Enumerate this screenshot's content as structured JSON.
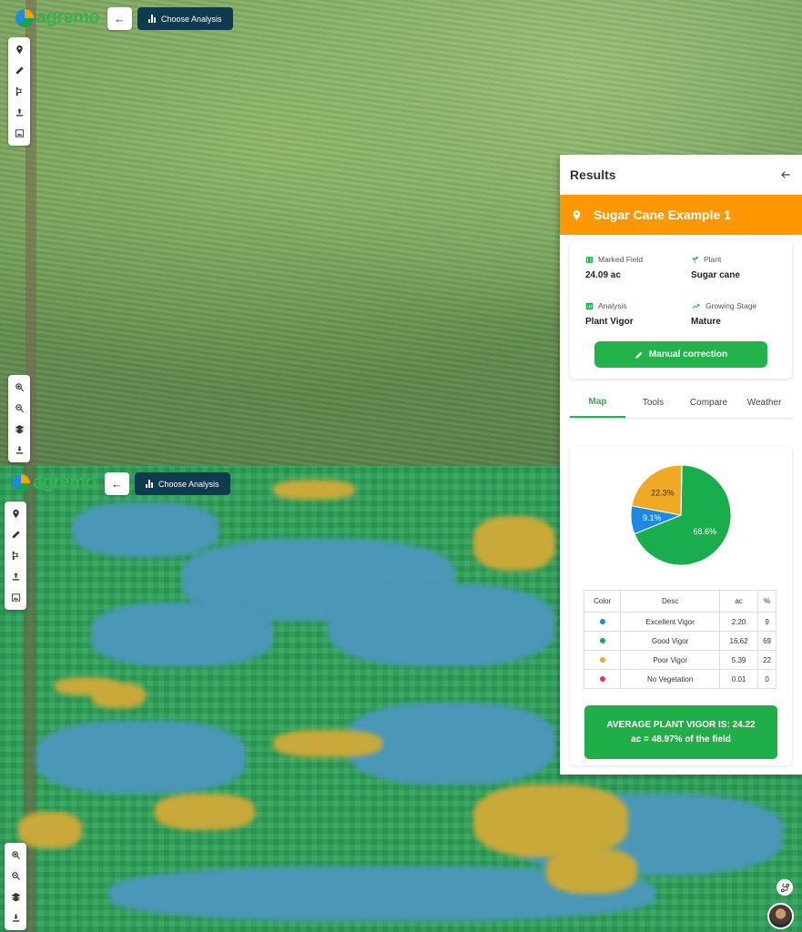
{
  "app": {
    "logo_text": "agremo"
  },
  "toolbar": {
    "back_icon": "←",
    "choose_analysis_label": "Choose Analysis"
  },
  "tools": [
    "pin-icon",
    "ruler-icon",
    "flag-icon",
    "upload-icon",
    "image-icon"
  ],
  "zoom_tools": [
    "zoom-in-icon",
    "zoom-out-icon",
    "layers-icon",
    "download-icon"
  ],
  "results": {
    "title": "Results",
    "field_name": "Sugar Cane Example 1",
    "info": {
      "marked_field_label": "Marked Field",
      "marked_field_value": "24.09 ac",
      "plant_label": "Plant",
      "plant_value": "Sugar cane",
      "analysis_label": "Analysis",
      "analysis_value": "Plant Vigor",
      "growing_stage_label": "Growing Stage",
      "growing_stage_value": "Mature"
    },
    "manual_correction_label": "Manual correction",
    "tabs": [
      {
        "label": "Map",
        "active": true
      },
      {
        "label": "Tools",
        "active": false
      },
      {
        "label": "Compare",
        "active": false
      },
      {
        "label": "Weather",
        "active": false
      }
    ],
    "table": {
      "headers": [
        "Color",
        "Desc",
        "ac",
        "%"
      ],
      "rows": [
        {
          "desc": "Excellent Vigor",
          "ac": "2.20",
          "pct": "9",
          "color": "#1e88e5"
        },
        {
          "desc": "Good Vigor",
          "ac": "16.62",
          "pct": "69",
          "color": "#1aad4e"
        },
        {
          "desc": "Poor Vigor",
          "ac": "5.39",
          "pct": "22",
          "color": "#eeaa22"
        },
        {
          "desc": "No Vegetation",
          "ac": "0.01",
          "pct": "0",
          "color": "#e53950"
        }
      ]
    },
    "average_line1": "AVERAGE PLANT VIGOR IS: 24.22",
    "average_line2": "ac = 48.97% of the field"
  },
  "chart_data": {
    "type": "pie",
    "categories": [
      "Good Vigor",
      "Excellent Vigor",
      "Poor Vigor",
      "No Vegetation"
    ],
    "values": [
      68.6,
      9.1,
      22.3,
      0.04
    ],
    "labels": [
      "68.6%",
      "9.1%",
      "22.3%",
      ""
    ],
    "colors": [
      "#1aad4e",
      "#1e88e5",
      "#eeaa22",
      "#e53950"
    ]
  }
}
